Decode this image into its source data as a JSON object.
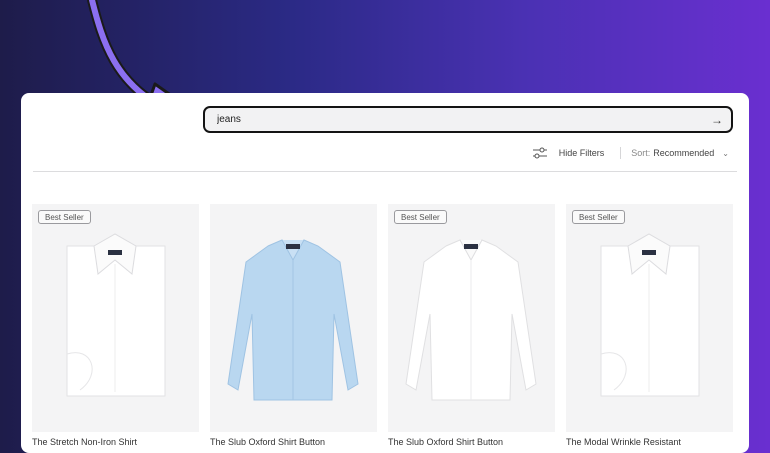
{
  "search": {
    "query": "jeans"
  },
  "toolbar": {
    "hide_filters": "Hide Filters",
    "sort_label": "Sort:",
    "sort_value": "Recommended"
  },
  "products": [
    {
      "badge": "Best Seller",
      "name": "The Stretch Non-Iron Shirt",
      "color": "#ffffff"
    },
    {
      "badge": "",
      "name": "The Slub Oxford Shirt Button",
      "color": "#b9d7f0"
    },
    {
      "badge": "Best Seller",
      "name": "The Slub Oxford Shirt Button",
      "color": "#ffffff"
    },
    {
      "badge": "Best Seller",
      "name": "The Modal Wrinkle Resistant",
      "color": "#ffffff"
    }
  ]
}
